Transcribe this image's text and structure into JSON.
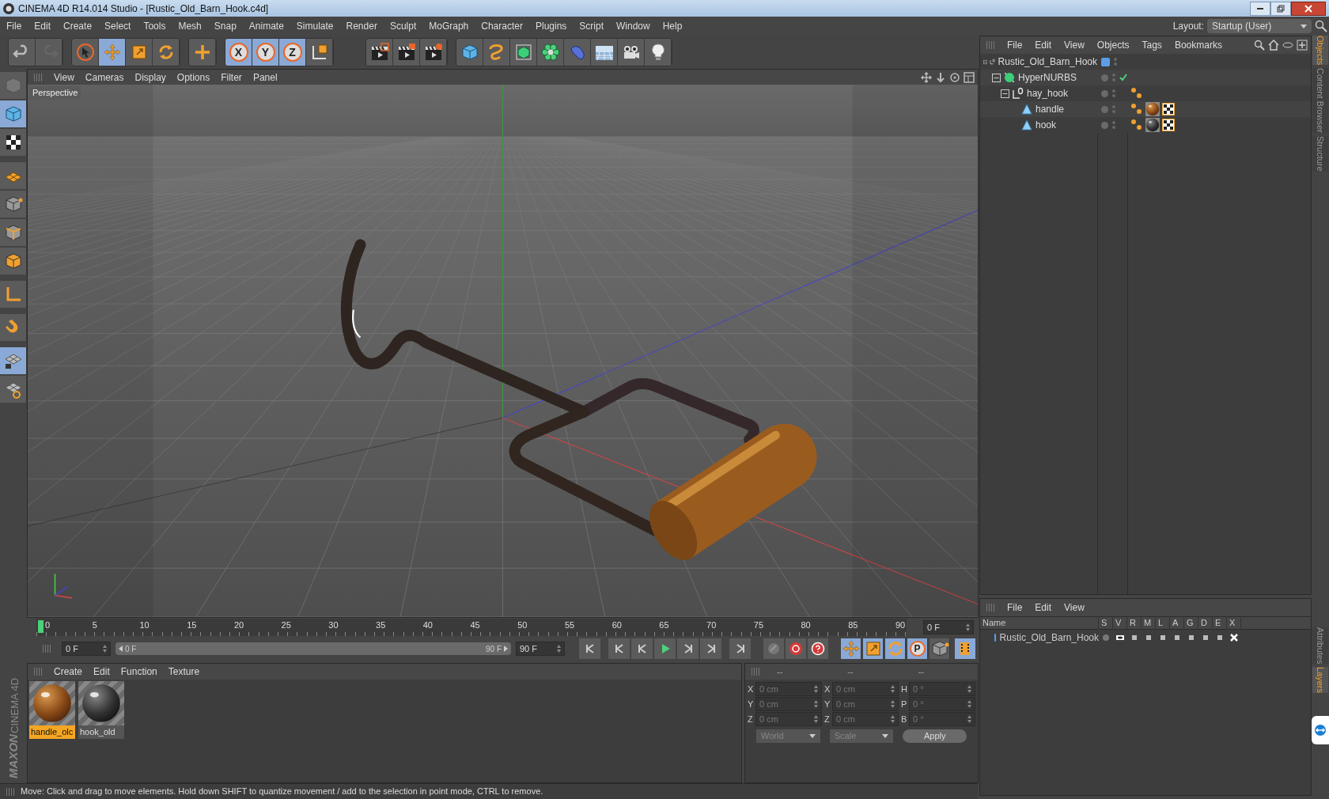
{
  "window": {
    "title": "CINEMA 4D R14.014 Studio - [Rustic_Old_Barn_Hook.c4d]"
  },
  "menu": [
    "File",
    "Edit",
    "Create",
    "Select",
    "Tools",
    "Mesh",
    "Snap",
    "Animate",
    "Simulate",
    "Render",
    "Sculpt",
    "MoGraph",
    "Character",
    "Plugins",
    "Script",
    "Window",
    "Help"
  ],
  "layout": {
    "label": "Layout:",
    "value": "Startup (User)"
  },
  "toolbar": [
    [
      {
        "kind": "undo",
        "selected": false
      },
      {
        "kind": "redo",
        "selected": false
      }
    ],
    [
      {
        "kind": "select",
        "selected": false
      },
      {
        "kind": "move",
        "selected": true
      },
      {
        "kind": "scale",
        "selected": false
      },
      {
        "kind": "rotate",
        "selected": false
      }
    ],
    [
      {
        "kind": "add",
        "selected": false
      }
    ],
    [
      {
        "kind": "axis",
        "label": "X",
        "selected": true
      },
      {
        "kind": "axis",
        "label": "Y",
        "selected": true
      },
      {
        "kind": "axis",
        "label": "Z",
        "selected": true
      },
      {
        "kind": "coord",
        "selected": false
      }
    ],
    [
      {
        "kind": "render-view",
        "selected": false
      },
      {
        "kind": "render-picture",
        "selected": false
      },
      {
        "kind": "render-settings",
        "selected": false
      }
    ],
    [
      {
        "kind": "cube",
        "selected": false
      },
      {
        "kind": "spline",
        "selected": false
      },
      {
        "kind": "nurbs",
        "selected": false
      },
      {
        "kind": "array",
        "selected": false
      },
      {
        "kind": "deformer",
        "selected": false
      },
      {
        "kind": "floor",
        "selected": false
      },
      {
        "kind": "camera",
        "selected": false
      },
      {
        "kind": "light",
        "selected": false
      }
    ]
  ],
  "left_tools": [
    {
      "kind": "editable",
      "selected": false
    },
    {
      "kind": "model",
      "selected": true
    },
    {
      "kind": "texture",
      "selected": false
    },
    {
      "kind": "workplane",
      "selected": false
    },
    {
      "kind": "points",
      "selected": false
    },
    {
      "kind": "edges",
      "selected": false
    },
    {
      "kind": "polygons",
      "selected": false
    },
    {
      "kind": "axis",
      "selected": false
    },
    {
      "kind": "magnet",
      "selected": false
    },
    {
      "kind": "grid-lock",
      "selected": true
    },
    {
      "kind": "grid-rotate",
      "selected": false
    }
  ],
  "logo": {
    "brand": "MAXON",
    "product": "CINEMA 4D"
  },
  "viewport": {
    "menu": [
      "View",
      "Cameras",
      "Display",
      "Options",
      "Filter",
      "Panel"
    ],
    "label": "Perspective"
  },
  "timeline": {
    "ticks": [
      "0",
      "5",
      "10",
      "15",
      "20",
      "25",
      "30",
      "35",
      "40",
      "45",
      "50",
      "55",
      "60",
      "65",
      "70",
      "75",
      "80",
      "85",
      "90"
    ],
    "current_frame": "0 F",
    "start": "0 F",
    "range_start": "0 F",
    "range_end": "90 F",
    "range_slider": {
      "level": 1
    },
    "end": "90 F",
    "key_modes": [
      {
        "kind": "move",
        "selected": true
      },
      {
        "kind": "scale",
        "selected": true
      },
      {
        "kind": "rotate",
        "selected": true
      },
      {
        "kind": "param",
        "label": "P",
        "selected": true
      },
      {
        "kind": "points",
        "selected": false
      }
    ]
  },
  "materials": {
    "menu": [
      "Create",
      "Edit",
      "Function",
      "Texture"
    ],
    "items": [
      {
        "name": "handle_olc",
        "kind": "wood",
        "selected": true
      },
      {
        "name": "hook_old",
        "kind": "metal",
        "selected": false
      }
    ]
  },
  "coordinates": {
    "headers": [
      "--",
      "--",
      "--"
    ],
    "disabled": true,
    "rows": [
      [
        {
          "axis": "X",
          "value": "0 cm"
        },
        {
          "axis": "X",
          "value": "0 cm"
        },
        {
          "axis": "H",
          "value": "0 °"
        }
      ],
      [
        {
          "axis": "Y",
          "value": "0 cm"
        },
        {
          "axis": "Y",
          "value": "0 cm"
        },
        {
          "axis": "P",
          "value": "0 °"
        }
      ],
      [
        {
          "axis": "Z",
          "value": "0 cm"
        },
        {
          "axis": "Z",
          "value": "0 cm"
        },
        {
          "axis": "B",
          "value": "0 °"
        }
      ]
    ],
    "dropdowns": [
      "World",
      "Scale"
    ],
    "apply": "Apply"
  },
  "status_bar": "Move: Click and drag to move elements. Hold down SHIFT to quantize movement / add to the selection in point mode, CTRL to remove.",
  "objects": {
    "menu": [
      "File",
      "Edit",
      "View",
      "Objects",
      "Tags",
      "Bookmarks"
    ],
    "tree": [
      {
        "name": "Rustic_Old_Barn_Hook",
        "kind": "null",
        "expanded": true,
        "color": "#5b9ee6",
        "enabled": false,
        "children": [
          {
            "name": "HyperNURBS",
            "kind": "nurbs",
            "expanded": true,
            "enabled": true,
            "children": [
              {
                "name": "hay_hook",
                "kind": "null",
                "expanded": true,
                "enabled": false,
                "tags": [
                  {
                    "kind": "phong"
                  }
                ],
                "children": [
                  {
                    "name": "handle",
                    "kind": "polygon",
                    "enabled": false,
                    "tags": [
                      {
                        "kind": "phong"
                      },
                      {
                        "kind": "wood"
                      },
                      {
                        "kind": "checker"
                      }
                    ]
                  },
                  {
                    "name": "hook",
                    "kind": "polygon",
                    "enabled": false,
                    "tags": [
                      {
                        "kind": "phong"
                      },
                      {
                        "kind": "metal"
                      },
                      {
                        "kind": "checker"
                      }
                    ]
                  }
                ]
              }
            ]
          }
        ]
      }
    ]
  },
  "side_tabs": [
    {
      "label": "Objects",
      "selected": true
    },
    {
      "label": "Content Browser",
      "selected": false
    },
    {
      "label": "Structure",
      "selected": false
    }
  ],
  "layers": {
    "menu": [
      "File",
      "Edit",
      "View"
    ],
    "columns": [
      "Name",
      "S",
      "V",
      "R",
      "M",
      "L",
      "A",
      "G",
      "D",
      "E",
      "X"
    ],
    "rows": [
      {
        "name": "Rustic_Old_Barn_Hook",
        "color": "#5b9ee6"
      }
    ]
  },
  "side_tabs_bottom": [
    {
      "label": "Attributes",
      "selected": false
    },
    {
      "label": "Layers",
      "selected": true
    }
  ]
}
